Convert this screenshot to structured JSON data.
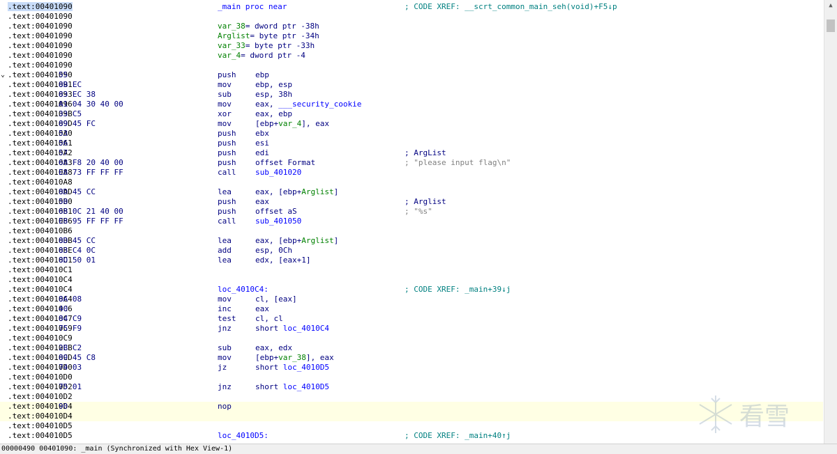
{
  "lines": [
    {
      "addr": ".text:00401090",
      "first": true,
      "label": "_main proc near",
      "comment": "; CODE XREF: __scrt_common_main_seh(void)+F5↓p",
      "comment_kind": "xref"
    },
    {
      "addr": ".text:00401090"
    },
    {
      "addr": ".text:00401090",
      "var": "var_38",
      "vardef": "= dword ptr -38h"
    },
    {
      "addr": ".text:00401090",
      "var": "Arglist",
      "vardef": "= byte ptr -34h"
    },
    {
      "addr": ".text:00401090",
      "var": "var_33",
      "vardef": "= byte ptr -33h"
    },
    {
      "addr": ".text:00401090",
      "var": "var_4",
      "vardef": "= dword ptr -4"
    },
    {
      "addr": ".text:00401090"
    },
    {
      "addr": ".text:00401090",
      "arrow": true,
      "bytes": "55",
      "mnem": "push",
      "ops": "ebp"
    },
    {
      "addr": ".text:00401091",
      "bytes": "8B EC",
      "mnem": "mov",
      "ops": "ebp, esp"
    },
    {
      "addr": ".text:00401093",
      "bytes": "83 EC 38",
      "mnem": "sub",
      "ops": "esp, 38h"
    },
    {
      "addr": ".text:00401096",
      "bytes": "A1 04 30 40 00",
      "mnem": "mov",
      "ops": "eax, ___security_cookie"
    },
    {
      "addr": ".text:0040109B",
      "bytes": "33 C5",
      "mnem": "xor",
      "ops": "eax, ebp"
    },
    {
      "addr": ".text:0040109D",
      "bytes": "89 45 FC",
      "mnem": "mov",
      "ops": "[ebp+var_4], eax"
    },
    {
      "addr": ".text:004010A0",
      "bytes": "53",
      "mnem": "push",
      "ops": "ebx"
    },
    {
      "addr": ".text:004010A1",
      "bytes": "56",
      "mnem": "push",
      "ops": "esi"
    },
    {
      "addr": ".text:004010A2",
      "bytes": "57",
      "mnem": "push",
      "ops": "edi",
      "comment": "; ArgList",
      "comment_kind": "kw"
    },
    {
      "addr": ".text:004010A3",
      "bytes": "68 F8 20 40 00",
      "mnem": "push",
      "ops": "offset Format",
      "comment": "; \"please input flag\\n\"",
      "comment_kind": "str"
    },
    {
      "addr": ".text:004010A8",
      "bytes": "E8 73 FF FF FF",
      "mnem": "call",
      "ops": "sub_401020"
    },
    {
      "addr": ".text:004010A8"
    },
    {
      "addr": ".text:004010AD",
      "bytes": "8D 45 CC",
      "mnem": "lea",
      "ops": "eax, [ebp+Arglist]"
    },
    {
      "addr": ".text:004010B0",
      "bytes": "50",
      "mnem": "push",
      "ops": "eax",
      "comment": "; Arglist",
      "comment_kind": "kw"
    },
    {
      "addr": ".text:004010B1",
      "bytes": "68 0C 21 40 00",
      "mnem": "push",
      "ops": "offset aS",
      "comment": "; \"%s\"",
      "comment_kind": "str"
    },
    {
      "addr": ".text:004010B6",
      "bytes": "E8 95 FF FF FF",
      "mnem": "call",
      "ops": "sub_401050"
    },
    {
      "addr": ".text:004010B6"
    },
    {
      "addr": ".text:004010BB",
      "bytes": "8D 45 CC",
      "mnem": "lea",
      "ops": "eax, [ebp+Arglist]"
    },
    {
      "addr": ".text:004010BE",
      "bytes": "83 C4 0C",
      "mnem": "add",
      "ops": "esp, 0Ch"
    },
    {
      "addr": ".text:004010C1",
      "bytes": "8D 50 01",
      "mnem": "lea",
      "ops": "edx, [eax+1]"
    },
    {
      "addr": ".text:004010C1"
    },
    {
      "addr": ".text:004010C4"
    },
    {
      "addr": ".text:004010C4",
      "label": "loc_4010C4:",
      "comment": "; CODE XREF: _main+39↓j",
      "comment_kind": "xref"
    },
    {
      "addr": ".text:004010C4",
      "bytes": "8A 08",
      "mnem": "mov",
      "ops": "cl, [eax]"
    },
    {
      "addr": ".text:004010C6",
      "bytes": "40",
      "mnem": "inc",
      "ops": "eax"
    },
    {
      "addr": ".text:004010C7",
      "bytes": "84 C9",
      "mnem": "test",
      "ops": "cl, cl"
    },
    {
      "addr": ".text:004010C9",
      "bytes": "75 F9",
      "mnem": "jnz",
      "ops": "short loc_4010C4"
    },
    {
      "addr": ".text:004010C9"
    },
    {
      "addr": ".text:004010CB",
      "bytes": "2B C2",
      "mnem": "sub",
      "ops": "eax, edx"
    },
    {
      "addr": ".text:004010CD",
      "bytes": "89 45 C8",
      "mnem": "mov",
      "ops": "[ebp+var_38], eax"
    },
    {
      "addr": ".text:004010D0",
      "bytes": "74 03",
      "mnem": "jz",
      "ops": "short loc_4010D5"
    },
    {
      "addr": ".text:004010D0"
    },
    {
      "addr": ".text:004010D2",
      "bytes": "75 01",
      "mnem": "jnz",
      "ops": "short loc_4010D5"
    },
    {
      "addr": ".text:004010D2"
    },
    {
      "addr": ".text:004010D4",
      "bytes": "90",
      "mnem": "nop",
      "highlight": true
    },
    {
      "addr": ".text:004010D4",
      "highlight": true
    },
    {
      "addr": ".text:004010D5"
    },
    {
      "addr": ".text:004010D5",
      "label": "loc_4010D5:",
      "comment": "; CODE XREF: _main+40↑j",
      "comment_kind": "xref"
    }
  ],
  "status_bar": {
    "text": "00000490 00401090: _main (Synchronized with Hex View-1)"
  },
  "watermark": {
    "text": "看雪"
  },
  "colors": {
    "highlight_row": "#ffffe4",
    "selected_addr": "#c8dcf8"
  }
}
